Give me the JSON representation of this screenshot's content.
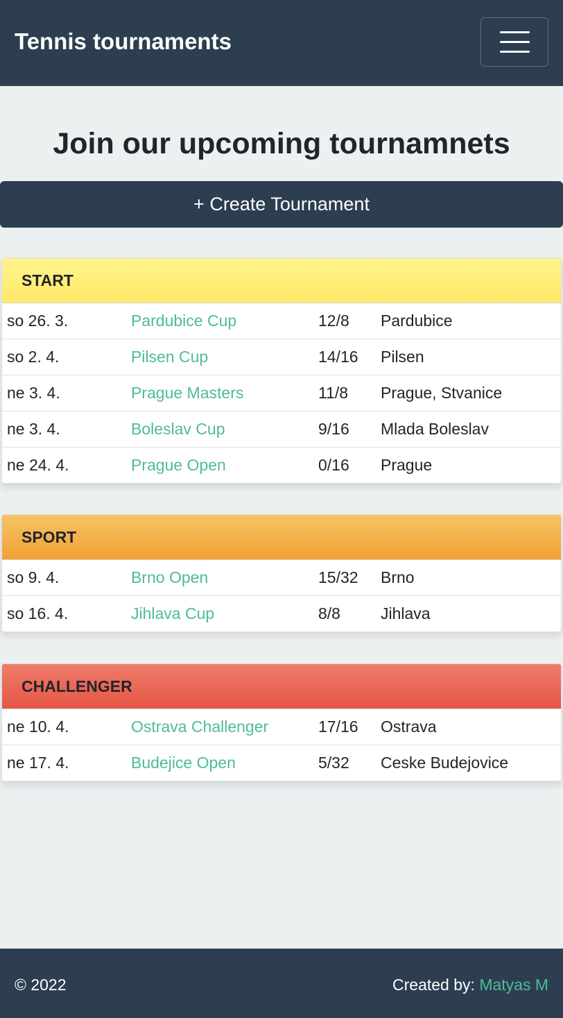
{
  "navbar": {
    "brand": "Tennis tournaments",
    "menu_icon": "hamburger-menu-icon"
  },
  "main": {
    "title": "Join our upcoming tournamnets",
    "create_button": "+ Create Tournament"
  },
  "categories": [
    {
      "name": "START",
      "tournaments": [
        {
          "date": "so 26. 3.",
          "name": "Pardubice Cup",
          "players": "12/8",
          "place": "Pardubice"
        },
        {
          "date": "so 2. 4.",
          "name": "Pilsen Cup",
          "players": "14/16",
          "place": "Pilsen"
        },
        {
          "date": "ne 3. 4.",
          "name": "Prague Masters",
          "players": "11/8",
          "place": "Prague, Stvanice"
        },
        {
          "date": "ne 3. 4.",
          "name": "Boleslav Cup",
          "players": "9/16",
          "place": "Mlada Boleslav"
        },
        {
          "date": "ne 24. 4.",
          "name": "Prague Open",
          "players": "0/16",
          "place": "Prague"
        }
      ]
    },
    {
      "name": "SPORT",
      "tournaments": [
        {
          "date": "so 9. 4.",
          "name": "Brno Open",
          "players": "15/32",
          "place": "Brno"
        },
        {
          "date": "so 16. 4.",
          "name": "Jihlava Cup",
          "players": "8/8",
          "place": "Jihlava"
        }
      ]
    },
    {
      "name": "CHALLENGER",
      "tournaments": [
        {
          "date": "ne 10. 4.",
          "name": "Ostrava Challenger",
          "players": "17/16",
          "place": "Ostrava"
        },
        {
          "date": "ne 17. 4.",
          "name": "Budejice Open",
          "players": "5/32",
          "place": "Ceske Budejovice"
        }
      ]
    }
  ],
  "footer": {
    "copyright": "© 2022",
    "created_by_label": "Created by:",
    "author": "Matyas M"
  },
  "colors": {
    "navbar": "#2c3e50",
    "background": "#ecf0f1",
    "link": "#4fbc95",
    "start_header": "#ffe866",
    "sport_header": "#f1a033",
    "challenger_header": "#e55645"
  }
}
